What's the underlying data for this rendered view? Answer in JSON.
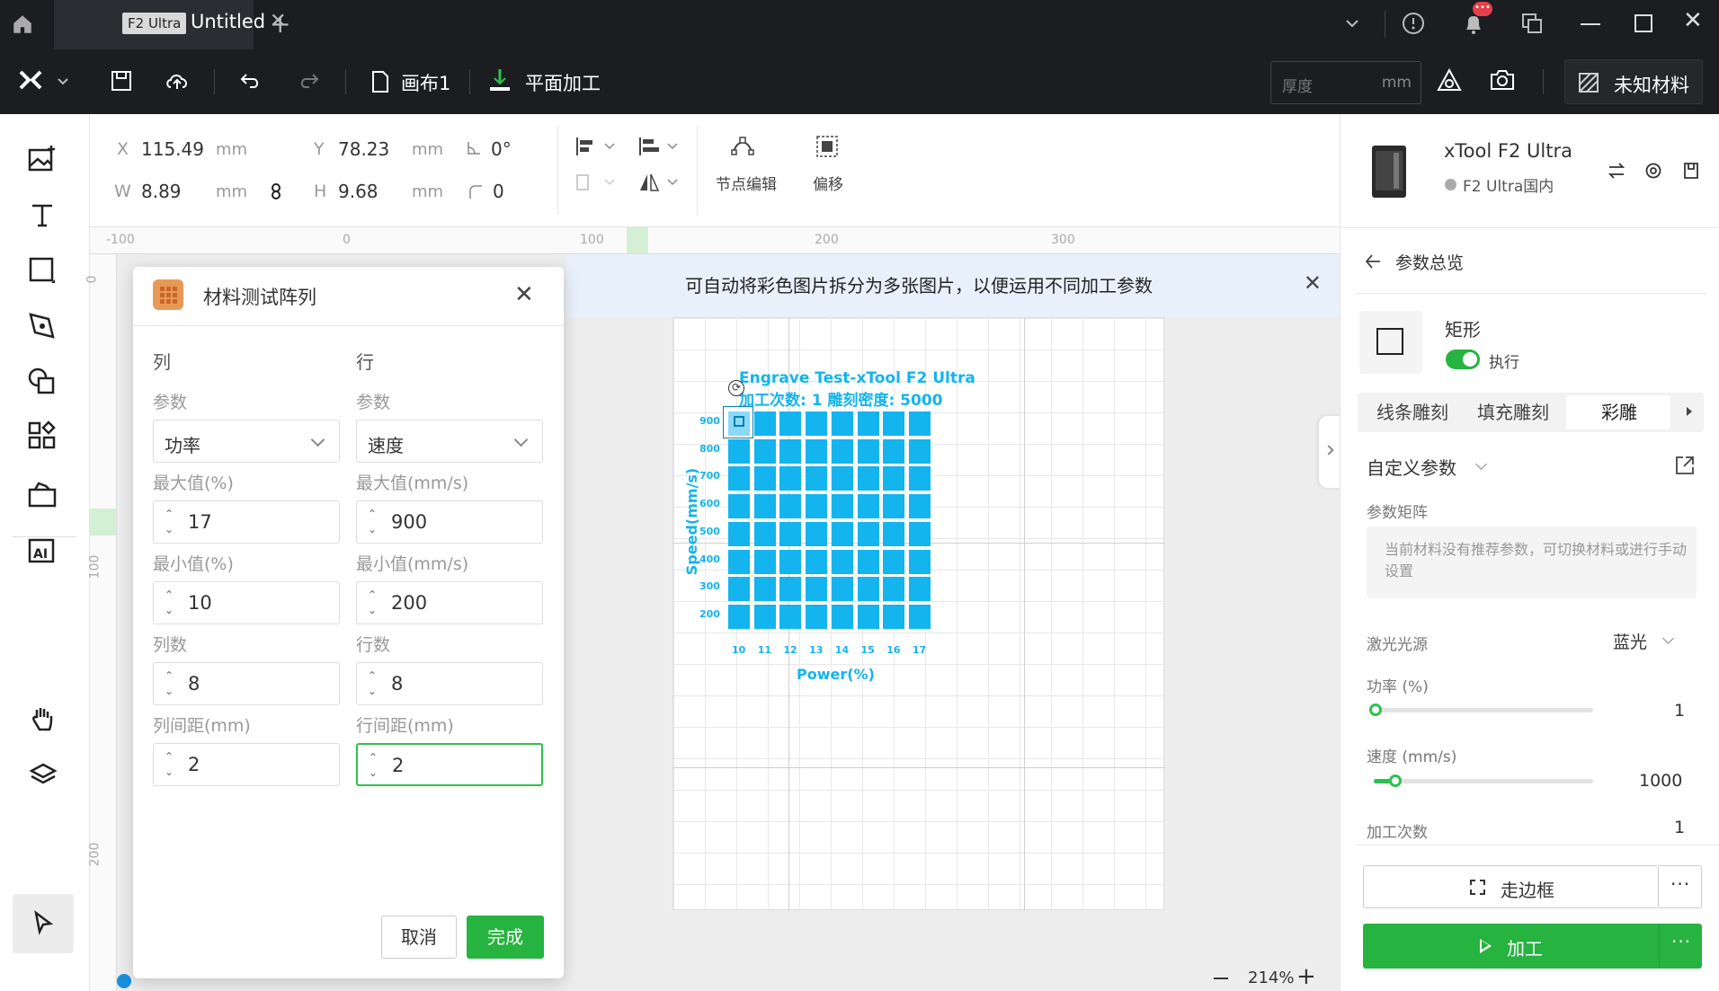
{
  "titlebar": {
    "badge": "F2 Ultra",
    "doc_title": "Untitled",
    "notification_count": "•••"
  },
  "toolbar": {
    "canvas_name": "画布1",
    "process_mode": "平面加工",
    "thickness_placeholder": "厚度",
    "thickness_unit": "mm",
    "material": "未知材料"
  },
  "props": {
    "x_label": "X",
    "x_value": "115.49",
    "x_unit": "mm",
    "y_label": "Y",
    "y_value": "78.23",
    "y_unit": "mm",
    "angle_value": "0°",
    "w_label": "W",
    "w_value": "8.89",
    "w_unit": "mm",
    "h_label": "H",
    "h_value": "9.68",
    "h_unit": "mm",
    "corner_value": "0",
    "node_edit": "节点编辑",
    "offset": "偏移"
  },
  "ruler": {
    "top": [
      "-100",
      "0",
      "100",
      "200",
      "300"
    ],
    "left": [
      "0",
      "100",
      "200"
    ]
  },
  "banner": {
    "text": "可自动将彩色图片拆分为多张图片，以便运用不同加工参数"
  },
  "dialog": {
    "title": "材料测试阵列",
    "col_header": "列",
    "row_header": "行",
    "param_label": "参数",
    "col_param": "功率",
    "row_param": "速度",
    "col_max_label": "最大值(%)",
    "col_max": "17",
    "row_max_label": "最大值(mm/s)",
    "row_max": "900",
    "col_min_label": "最小值(%)",
    "col_min": "10",
    "row_min_label": "最小值(mm/s)",
    "row_min": "200",
    "col_count_label": "列数",
    "col_count": "8",
    "row_count_label": "行数",
    "row_count": "8",
    "col_gap_label": "列间距(mm)",
    "col_gap": "2",
    "row_gap_label": "行间距(mm)",
    "row_gap": "2",
    "cancel": "取消",
    "ok": "完成"
  },
  "test_grid": {
    "title_line1": "Engrave Test-xTool F2 Ultra",
    "title_line2": "加工次数: 1 雕刻密度: 5000",
    "y_axis_label": "Speed(mm/s)",
    "x_axis_label": "Power(%)",
    "speed_labels": [
      "900",
      "800",
      "700",
      "600",
      "500",
      "400",
      "300",
      "200"
    ],
    "power_labels": [
      "10",
      "11",
      "12",
      "13",
      "14",
      "15",
      "16",
      "17"
    ],
    "color": "#14b4ee"
  },
  "zoom": {
    "level": "214%"
  },
  "right": {
    "device_name": "xTool F2 Ultra",
    "device_region": "F2 Ultra国内",
    "back_title": "参数总览",
    "shape_name": "矩形",
    "execute_label": "执行",
    "tabs": [
      "线条雕刻",
      "填充雕刻",
      "彩雕"
    ],
    "custom_params": "自定义参数",
    "matrix_label": "参数矩阵",
    "matrix_hint": "当前材料没有推荐参数，可切换材料或进行手动设置",
    "laser_label": "激光光源",
    "laser_value": "蓝光",
    "power_label": "功率 (%)",
    "power_value": "1",
    "power_level": 1,
    "speed_label": "速度 (mm/s)",
    "speed_value": "1000",
    "speed_level": 10,
    "passes_label": "加工次数",
    "passes_value": "1",
    "frame_button": "走边框",
    "process_button": "加工"
  },
  "colors": {
    "accent": "#27b33f",
    "dark": "#1c1d21",
    "grid_blue": "#14b4ee"
  }
}
